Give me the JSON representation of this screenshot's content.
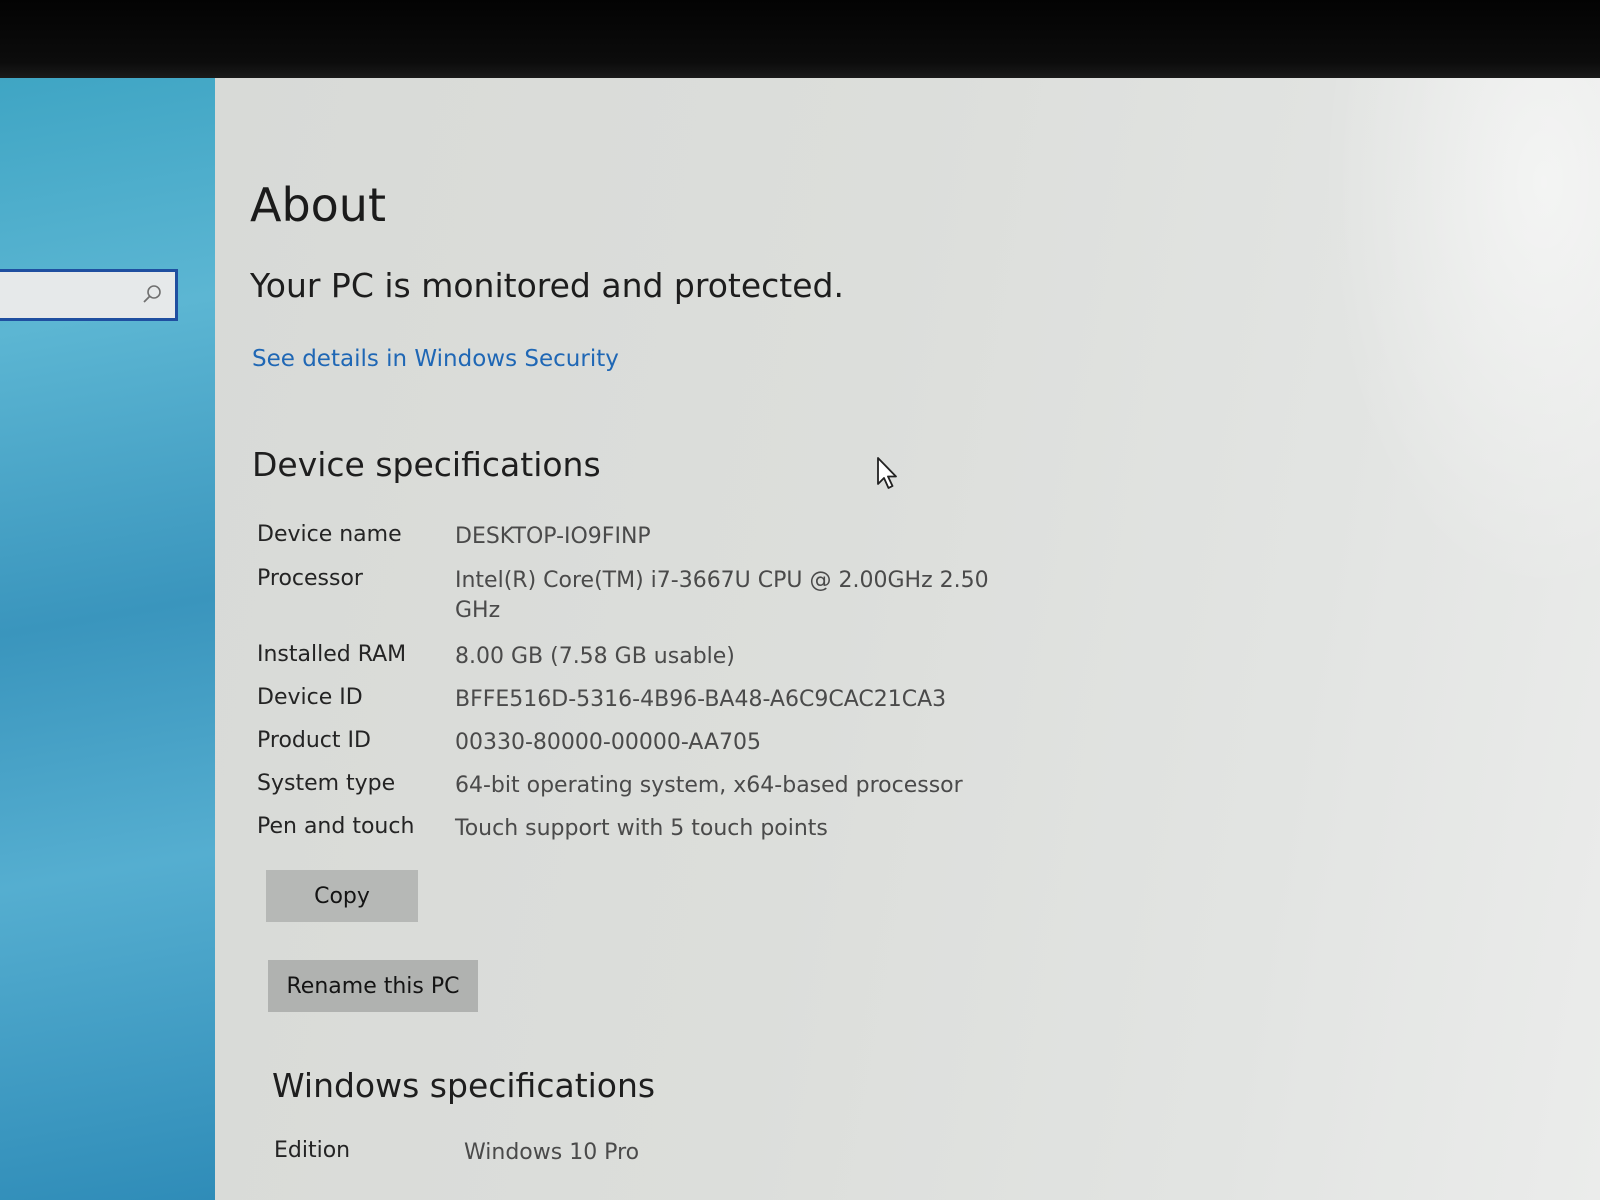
{
  "search": {
    "value": "",
    "icon": "search-icon"
  },
  "about": {
    "title": "About",
    "protection_status": "Your PC is monitored and protected.",
    "security_link": "See details in Windows Security"
  },
  "device_specs": {
    "heading": "Device specifications",
    "rows": [
      {
        "label": "Device name",
        "value": "DESKTOP-IO9FINP"
      },
      {
        "label": "Processor",
        "value": "Intel(R) Core(TM) i7-3667U CPU @ 2.00GHz   2.50 GHz"
      },
      {
        "label": "Installed RAM",
        "value": "8.00 GB (7.58 GB usable)"
      },
      {
        "label": "Device ID",
        "value": "BFFE516D-5316-4B96-BA48-A6C9CAC21CA3"
      },
      {
        "label": "Product ID",
        "value": "00330-80000-00000-AA705"
      },
      {
        "label": "System type",
        "value": "64-bit operating system, x64-based processor"
      },
      {
        "label": "Pen and touch",
        "value": "Touch support with 5 touch points"
      }
    ],
    "copy_label": "Copy",
    "rename_label": "Rename this PC"
  },
  "windows_specs": {
    "heading": "Windows specifications",
    "rows": [
      {
        "label": "Edition",
        "value": "Windows 10 Pro"
      }
    ]
  },
  "colors": {
    "link": "#1f67b5",
    "search_border": "#1f4fa0",
    "sidebar": "#3fa5c4",
    "button": "#b6b8b6"
  }
}
